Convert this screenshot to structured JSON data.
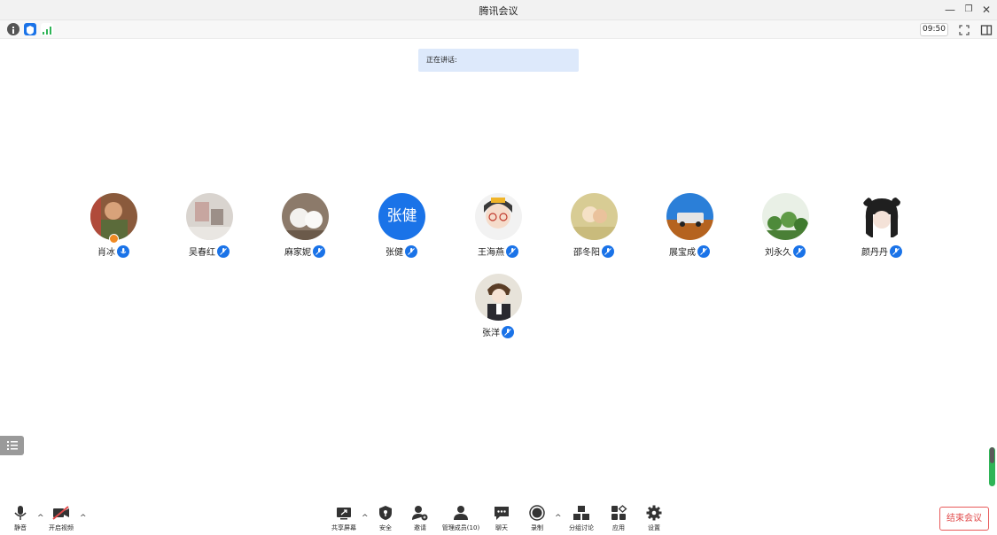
{
  "window": {
    "title": "腾讯会议",
    "minimize": "—",
    "restore": "❐",
    "close": "✕"
  },
  "toolbar": {
    "timer": "09:50",
    "icons": [
      "info-icon",
      "shield-icon",
      "signal-icon",
      "fullscreen-icon",
      "sidebar-toggle-icon"
    ]
  },
  "speaking": {
    "label": "正在讲话:"
  },
  "participants": [
    {
      "name": "肖冰",
      "avatar": "photo",
      "host": true
    },
    {
      "name": "吴春红",
      "avatar": "photo"
    },
    {
      "name": "麻家妮",
      "avatar": "photo"
    },
    {
      "name": "张健",
      "avatar": "text",
      "avatar_text": "张健"
    },
    {
      "name": "王海燕",
      "avatar": "photo"
    },
    {
      "name": "邵冬阳",
      "avatar": "photo"
    },
    {
      "name": "展宝成",
      "avatar": "photo"
    },
    {
      "name": "刘永久",
      "avatar": "photo"
    },
    {
      "name": "颜丹丹",
      "avatar": "photo"
    },
    {
      "name": "张洋",
      "avatar": "photo"
    }
  ],
  "bottom": {
    "mute": "静音",
    "video": "开启视频",
    "share": "共享屏幕",
    "security": "安全",
    "invite": "邀请",
    "members": "管理成员(10)",
    "chat": "聊天",
    "record": "录制",
    "breakout": "分组讨论",
    "apps": "应用",
    "settings": "设置",
    "end": "结束会议"
  },
  "colors": {
    "accent": "#1a73e8",
    "end_red": "#e04848",
    "speaking_bg": "#dde9fb"
  }
}
